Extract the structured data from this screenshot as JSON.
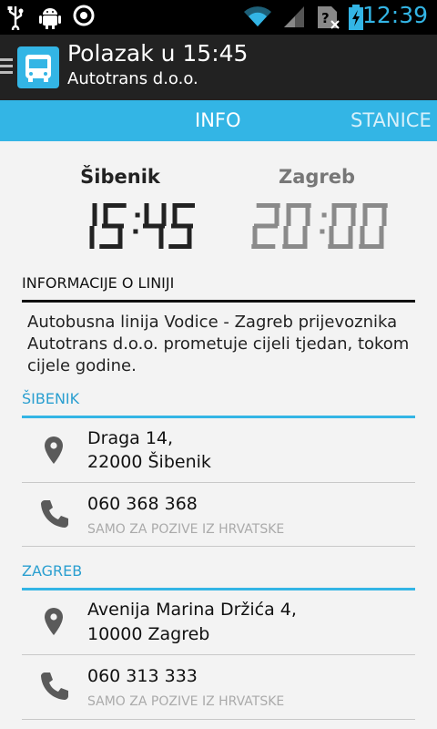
{
  "status": {
    "time": "12:39"
  },
  "actionbar": {
    "title": "Polazak u 15:45",
    "subtitle": "Autotrans d.o.o."
  },
  "tabs": [
    {
      "label": "INFO"
    },
    {
      "label": "STANICE"
    }
  ],
  "departure": {
    "city": "Šibenik",
    "time": "15:45"
  },
  "arrival": {
    "city": "Zagreb",
    "time": "20:00"
  },
  "info": {
    "header": "INFORMACIJE O LINIJI",
    "description": "Autobusna linija Vodice - Zagreb prijevoznika Autotrans d.o.o. prometuje cijeli tjedan, tokom cijele godine."
  },
  "stations": [
    {
      "name": "ŠIBENIK",
      "address_line1": "Draga 14,",
      "address_line2": "22000 Šibenik",
      "phone": "060 368 368",
      "phone_note": "SAMO ZA POZIVE IZ HRVATSKE"
    },
    {
      "name": "ZAGREB",
      "address_line1": "Avenija Marina Držića 4,",
      "address_line2": "10000 Zagreb",
      "phone": "060 313 333",
      "phone_note": "SAMO ZA POZIVE IZ HRVATSKE"
    }
  ],
  "colors": {
    "accent": "#33b5e5",
    "actionbar": "#222222",
    "lcd_active": "#222222",
    "lcd_inactive": "#8a8a8a"
  },
  "icons": [
    "usb-icon",
    "android-debug-icon",
    "app-notification-icon",
    "wifi-icon",
    "signal-icon",
    "no-sim-icon",
    "battery-icon",
    "drawer-icon",
    "bus-app-icon",
    "location-pin-icon",
    "phone-icon"
  ]
}
